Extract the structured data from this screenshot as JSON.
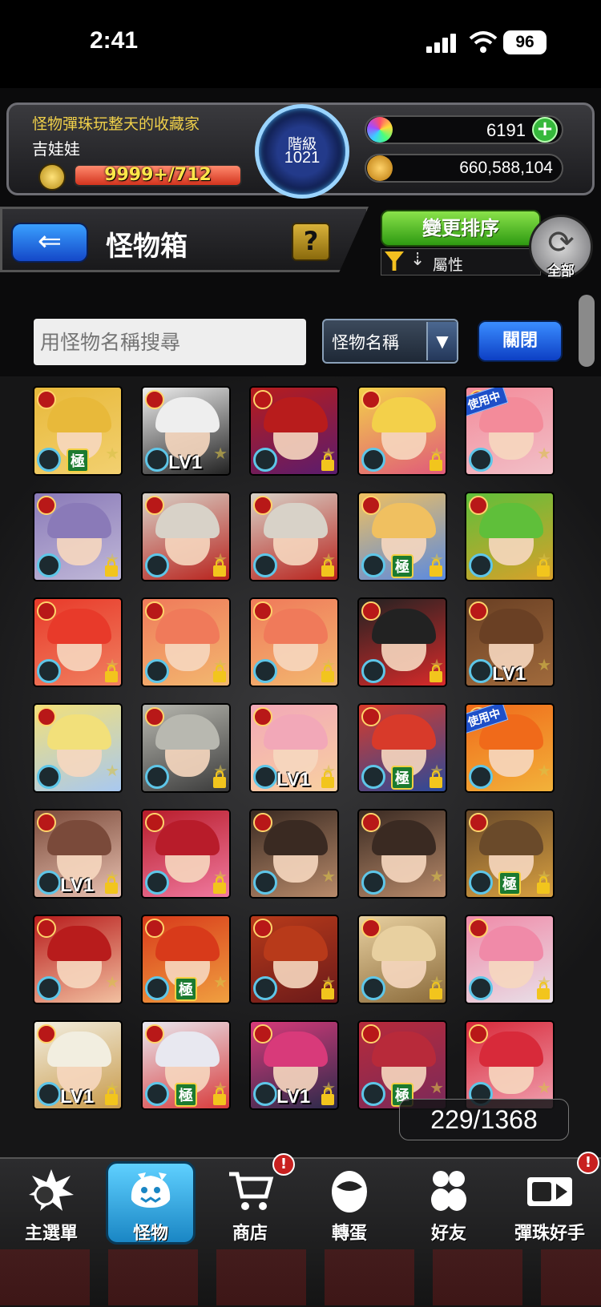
{
  "status_bar": {
    "time": "2:41",
    "battery": "96"
  },
  "player": {
    "title": "怪物彈珠玩整天的收藏家",
    "name": "吉娃娃",
    "stamina": "9999+/712",
    "rank_label": "階級",
    "rank_value": "1021",
    "orbs": "6191",
    "gold": "660,588,104"
  },
  "header": {
    "title": "怪物箱",
    "help": "?",
    "sort_button": "變更排序",
    "filter_label": "屬性",
    "refresh_label": "全部"
  },
  "search": {
    "placeholder": "用怪物名稱搜尋",
    "type_value": "怪物名稱",
    "close_label": "關閉"
  },
  "box_count": "229/1368",
  "monsters": [
    {
      "lv": "",
      "extreme": "極",
      "using": "",
      "locked": false,
      "colors": [
        "#e8b93a",
        "#f2d070"
      ]
    },
    {
      "lv": "LV1",
      "extreme": "",
      "using": "",
      "locked": false,
      "colors": [
        "#eeeeee",
        "#222222"
      ]
    },
    {
      "lv": "",
      "extreme": "",
      "using": "",
      "locked": true,
      "colors": [
        "#b81c1c",
        "#5a1c6e"
      ]
    },
    {
      "lv": "",
      "extreme": "",
      "using": "",
      "locked": true,
      "colors": [
        "#f3d04a",
        "#e05a7a"
      ]
    },
    {
      "lv": "",
      "extreme": "",
      "using": "使用中",
      "locked": false,
      "colors": [
        "#f38b9a",
        "#f2c0c8"
      ]
    },
    {
      "lv": "",
      "extreme": "",
      "using": "",
      "locked": true,
      "colors": [
        "#8a7ab8",
        "#c0b8d8"
      ]
    },
    {
      "lv": "",
      "extreme": "",
      "using": "",
      "locked": true,
      "colors": [
        "#d8d2c8",
        "#b8221c"
      ]
    },
    {
      "lv": "",
      "extreme": "",
      "using": "",
      "locked": true,
      "colors": [
        "#d8d2c8",
        "#b8221c"
      ]
    },
    {
      "lv": "",
      "extreme": "極",
      "using": "",
      "locked": true,
      "colors": [
        "#f0c060",
        "#5a8ae0"
      ]
    },
    {
      "lv": "",
      "extreme": "",
      "using": "",
      "locked": true,
      "colors": [
        "#5fbf3a",
        "#d8a02a"
      ]
    },
    {
      "lv": "",
      "extreme": "",
      "using": "",
      "locked": true,
      "colors": [
        "#e83a2a",
        "#f08060"
      ]
    },
    {
      "lv": "",
      "extreme": "",
      "using": "",
      "locked": true,
      "colors": [
        "#f07a5a",
        "#f2b870"
      ]
    },
    {
      "lv": "",
      "extreme": "",
      "using": "",
      "locked": true,
      "colors": [
        "#f07a5a",
        "#f2b870"
      ]
    },
    {
      "lv": "",
      "extreme": "",
      "using": "",
      "locked": true,
      "colors": [
        "#222222",
        "#d82a2a"
      ]
    },
    {
      "lv": "LV1",
      "extreme": "",
      "using": "",
      "locked": false,
      "colors": [
        "#6a4024",
        "#a06a3c"
      ]
    },
    {
      "lv": "",
      "extreme": "",
      "using": "",
      "locked": false,
      "colors": [
        "#f2e07a",
        "#a8c8f0"
      ]
    },
    {
      "lv": "",
      "extreme": "",
      "using": "",
      "locked": true,
      "colors": [
        "#b8b8b0",
        "#3a3a3a"
      ]
    },
    {
      "lv": "LV1",
      "extreme": "",
      "using": "",
      "locked": true,
      "colors": [
        "#f2a8b8",
        "#f8d0a0"
      ]
    },
    {
      "lv": "",
      "extreme": "極",
      "using": "",
      "locked": true,
      "colors": [
        "#d83a2a",
        "#2a4a9a"
      ]
    },
    {
      "lv": "",
      "extreme": "",
      "using": "使用中",
      "locked": false,
      "colors": [
        "#f06a1a",
        "#f2b23a"
      ]
    },
    {
      "lv": "LV1",
      "extreme": "",
      "using": "",
      "locked": true,
      "colors": [
        "#7a4a3a",
        "#e8c0b0"
      ]
    },
    {
      "lv": "",
      "extreme": "",
      "using": "",
      "locked": true,
      "colors": [
        "#b81c2a",
        "#f07aa0"
      ]
    },
    {
      "lv": "",
      "extreme": "",
      "using": "",
      "locked": false,
      "colors": [
        "#3a2a22",
        "#b88a6a"
      ]
    },
    {
      "lv": "",
      "extreme": "",
      "using": "",
      "locked": false,
      "colors": [
        "#3a2a22",
        "#b88a6a"
      ]
    },
    {
      "lv": "",
      "extreme": "極",
      "using": "",
      "locked": true,
      "colors": [
        "#6a4a2a",
        "#d8a040"
      ]
    },
    {
      "lv": "",
      "extreme": "",
      "using": "",
      "locked": false,
      "colors": [
        "#b81c1c",
        "#f2c0a0"
      ]
    },
    {
      "lv": "",
      "extreme": "極",
      "using": "",
      "locked": false,
      "colors": [
        "#d83a1a",
        "#f0a040"
      ]
    },
    {
      "lv": "",
      "extreme": "",
      "using": "",
      "locked": true,
      "colors": [
        "#b83a1a",
        "#6a1a1a"
      ]
    },
    {
      "lv": "",
      "extreme": "",
      "using": "",
      "locked": true,
      "colors": [
        "#e8d0a0",
        "#8a6a3a"
      ]
    },
    {
      "lv": "",
      "extreme": "",
      "using": "",
      "locked": true,
      "colors": [
        "#f08aa8",
        "#e8e0e8"
      ]
    },
    {
      "lv": "LV1",
      "extreme": "",
      "using": "",
      "locked": true,
      "colors": [
        "#f2eee0",
        "#c89a4a"
      ]
    },
    {
      "lv": "",
      "extreme": "極",
      "using": "",
      "locked": true,
      "colors": [
        "#e8e8f0",
        "#d83a3a"
      ]
    },
    {
      "lv": "LV1",
      "extreme": "",
      "using": "",
      "locked": true,
      "colors": [
        "#d83a7a",
        "#2a2a4a"
      ]
    },
    {
      "lv": "",
      "extreme": "極",
      "using": "",
      "locked": false,
      "colors": [
        "#b82a3a",
        "#7a2a5a"
      ]
    },
    {
      "lv": "",
      "extreme": "",
      "using": "",
      "locked": false,
      "colors": [
        "#d82a3a",
        "#f0a0b0"
      ]
    }
  ],
  "nav": {
    "items": [
      {
        "label": "主選單",
        "icon": "main-menu-icon",
        "badge": ""
      },
      {
        "label": "怪物",
        "icon": "monster-icon",
        "badge": ""
      },
      {
        "label": "商店",
        "icon": "cart-icon",
        "badge": "!"
      },
      {
        "label": "轉蛋",
        "icon": "gacha-egg-icon",
        "badge": ""
      },
      {
        "label": "好友",
        "icon": "friends-icon",
        "badge": ""
      },
      {
        "label": "彈珠好手",
        "icon": "card-icon",
        "badge": "!"
      }
    ]
  },
  "colors": {
    "accent_green": "#36b83c",
    "accent_blue": "#1448c8",
    "gold": "#f2c51d",
    "card_red": "#b81c1c"
  }
}
